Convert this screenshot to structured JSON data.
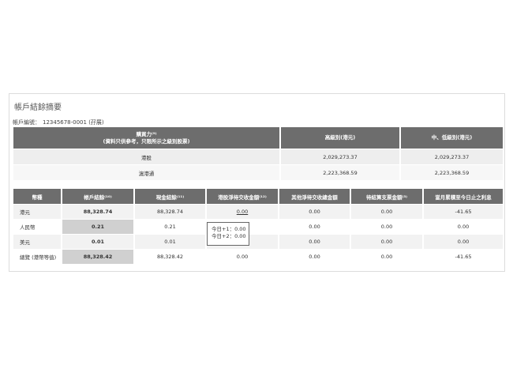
{
  "summary": {
    "title": "帳戶結餘摘要",
    "account_label": "帳戶編號：",
    "account_value": "12345678-0001 (孖展)"
  },
  "buying_power": {
    "headers": [
      "購買力⁽⁹⁾",
      "(資料只供參考，只限所示之級別股票)",
      "高級別(港元)",
      "中、低級別(港元)"
    ],
    "rows": [
      {
        "label": "港股",
        "high": "2,029,273.37",
        "mid_low": "2,029,273.37"
      },
      {
        "label": "滬港通",
        "high": "2,223,368.59",
        "mid_low": "2,223,368.59"
      }
    ]
  },
  "balances": {
    "headers": [
      "幣種",
      "帳戶結餘⁽¹⁰⁾",
      "現金結餘⁽¹¹⁾",
      "港股淨待交收金額⁽¹²⁾",
      "其他淨待交收總金額",
      "待結算支票金額⁽³⁾",
      "當月累積至今日止之利息"
    ],
    "rows": [
      {
        "currency": "港元",
        "account": "88,328.74",
        "cash": "88,328.74",
        "hk_pending": "0.00",
        "other_pending": "0.00",
        "cheque": "0.00",
        "interest": "-41.65"
      },
      {
        "currency": "人民幣",
        "account": "0.21",
        "cash": "0.21",
        "hk_pending": "",
        "other_pending": "0.00",
        "cheque": "0.00",
        "interest": "0.00"
      },
      {
        "currency": "美元",
        "account": "0.01",
        "cash": "0.01",
        "hk_pending": "",
        "other_pending": "0.00",
        "cheque": "0.00",
        "interest": "0.00"
      },
      {
        "currency": "總覽 (港幣等值)",
        "account": "88,328.42",
        "cash": "88,328.42",
        "hk_pending": "0.00",
        "other_pending": "0.00",
        "cheque": "0.00",
        "interest": "-41.65"
      }
    ]
  },
  "tooltip": {
    "line1": "今日+1：0.00",
    "line2": "今日+2：0.00"
  }
}
